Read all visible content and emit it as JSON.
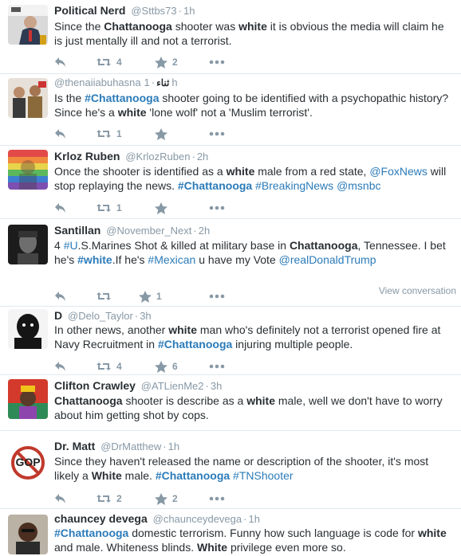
{
  "tweets": [
    {
      "name": "Political Nerd",
      "handle": "@Sttbs73",
      "time": "1h",
      "segments": [
        {
          "t": "Since the "
        },
        {
          "t": "Chattanooga",
          "b": true
        },
        {
          "t": " shooter was "
        },
        {
          "t": "white",
          "b": true
        },
        {
          "t": " it is obvious the media will claim he is just mentally ill and not a terrorist."
        }
      ],
      "retweets": "4",
      "likes": "2"
    },
    {
      "name": "",
      "handle": "@thenaiiabuhasna",
      "handle_extra": "ثناء",
      "time": "1h",
      "segments": [
        {
          "t": "Is the "
        },
        {
          "t": "#Chattanooga",
          "l": true,
          "b": true
        },
        {
          "t": " shooter going to be identified with a psychopathic history? Since he's a "
        },
        {
          "t": "white",
          "b": true
        },
        {
          "t": " 'lone wolf' not a 'Muslim terrorist'."
        }
      ],
      "retweets": "1",
      "likes": ""
    },
    {
      "name": "Krloz Ruben",
      "handle": "@KrlozRuben",
      "time": "2h",
      "segments": [
        {
          "t": "Once the shooter is identified as a "
        },
        {
          "t": "white",
          "b": true
        },
        {
          "t": " male from a red state, "
        },
        {
          "t": "@FoxNews",
          "l": true
        },
        {
          "t": " will stop replaying the news. "
        },
        {
          "t": "#Chattanooga",
          "l": true,
          "b": true
        },
        {
          "t": " "
        },
        {
          "t": "#BreakingNews",
          "l": true
        },
        {
          "t": " "
        },
        {
          "t": "@msnbc",
          "l": true
        }
      ],
      "retweets": "1",
      "likes": ""
    },
    {
      "name": "Santillan",
      "handle": "@November_Next",
      "time": "2h",
      "segments": [
        {
          "t": "4 "
        },
        {
          "t": "#U",
          "l": true
        },
        {
          "t": ".S.Marines Shot & killed at military base in "
        },
        {
          "t": "Chattanooga",
          "b": true
        },
        {
          "t": ", Tennessee. I bet he's "
        },
        {
          "t": "#white",
          "l": true,
          "b": true
        },
        {
          "t": ".If he's "
        },
        {
          "t": "#Mexican",
          "l": true
        },
        {
          "t": " u have my Vote "
        },
        {
          "t": "@realDonaldTrump",
          "l": true
        }
      ],
      "retweets": "",
      "likes": "1",
      "view_conversation": "View conversation"
    },
    {
      "name": "D",
      "handle": "@Delo_Taylor",
      "time": "3h",
      "segments": [
        {
          "t": "In other news, another "
        },
        {
          "t": "white",
          "b": true
        },
        {
          "t": " man who's definitely not a terrorist opened fire at Navy Recruitment in "
        },
        {
          "t": "#Chattanooga",
          "l": true,
          "b": true
        },
        {
          "t": " injuring multiple people."
        }
      ],
      "retweets": "4",
      "likes": "6"
    },
    {
      "name": "Clifton Crawley",
      "handle": "@ATLienMe2",
      "time": "3h",
      "segments": [
        {
          "t": "Chattanooga",
          "b": true
        },
        {
          "t": " shooter is describe as a "
        },
        {
          "t": "white",
          "b": true
        },
        {
          "t": " male, well we don't have to worry about him getting shot by cops."
        }
      ],
      "retweets": "",
      "likes": ""
    },
    {
      "name": "Dr. Matt",
      "handle": "@DrMatthew",
      "time": "1h",
      "segments": [
        {
          "t": "Since they haven't released the name or description of the shooter, it's most likely a "
        },
        {
          "t": "White",
          "b": true
        },
        {
          "t": " male.  "
        },
        {
          "t": "#Chattanooga",
          "l": true,
          "b": true
        },
        {
          "t": " "
        },
        {
          "t": "#TNShooter",
          "l": true
        }
      ],
      "retweets": "2",
      "likes": "2"
    },
    {
      "name": "chauncey devega",
      "handle": "@chaunceydevega",
      "time": "1h",
      "segments": [
        {
          "t": "#Chattanooga",
          "l": true,
          "b": true
        },
        {
          "t": " domestic terrorism. Funny how such language is code for "
        },
        {
          "t": "white",
          "b": true
        },
        {
          "t": " and male. Whiteness blinds. "
        },
        {
          "t": "White",
          "b": true
        },
        {
          "t": " privilege even more so."
        }
      ],
      "retweets": "",
      "likes": ""
    }
  ],
  "gop_logo_text": "GOP",
  "colors": {
    "link": "#2b7bb9",
    "meta": "#8899a6",
    "text": "#292f33",
    "separator": "#e1e8ed"
  },
  "icons": {
    "reply": "reply-icon",
    "retweet": "retweet-icon",
    "like": "star-icon",
    "more": "more-icon"
  }
}
